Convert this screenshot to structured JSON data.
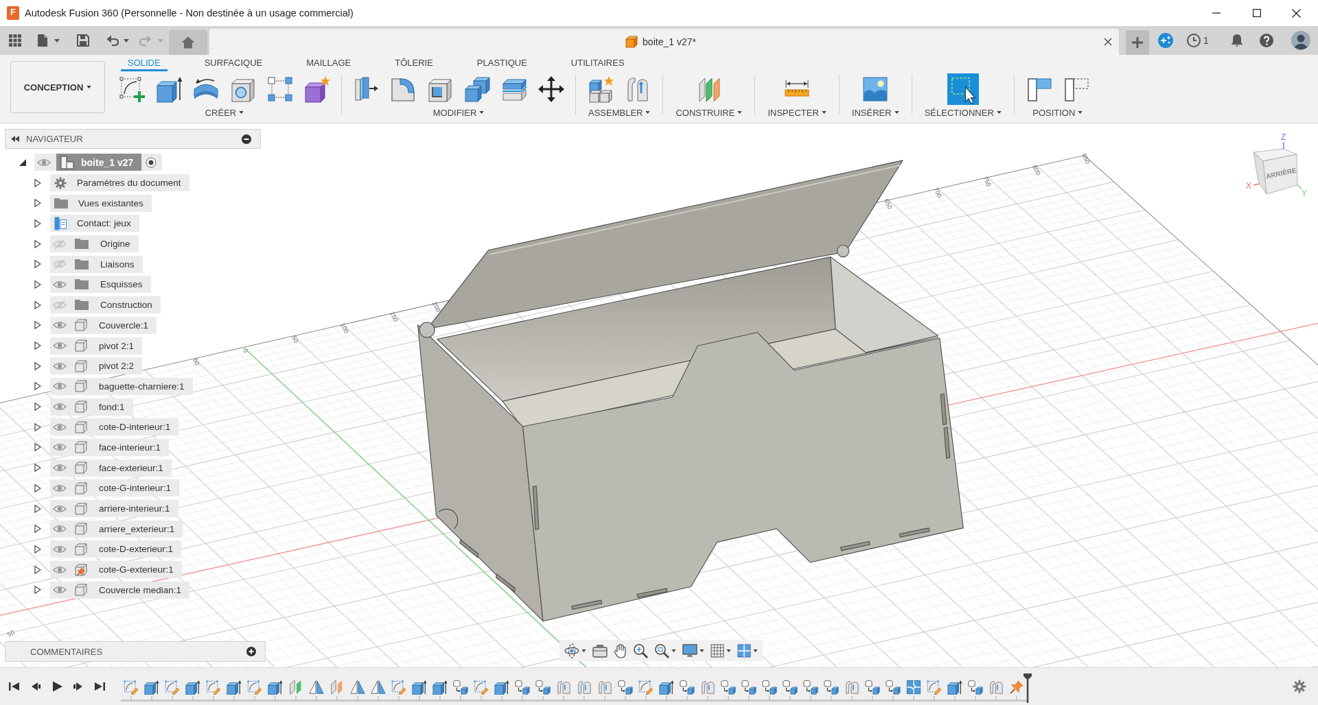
{
  "window": {
    "logo": "F",
    "title": "Autodesk Fusion 360 (Personnelle - Non destinée à un usage commercial)"
  },
  "document_tab": {
    "title": "boite_1 v27*"
  },
  "header_right": {
    "jobs_count": "1"
  },
  "workspace": {
    "label": "CONCEPTION"
  },
  "toolbar": {
    "tabs": [
      {
        "label": "SOLIDE",
        "selected": true
      },
      {
        "label": "SURFACIQUE",
        "selected": false
      },
      {
        "label": "MAILLAGE",
        "selected": false
      },
      {
        "label": "TÔLERIE",
        "selected": false
      },
      {
        "label": "PLASTIQUE",
        "selected": false
      },
      {
        "label": "UTILITAIRES",
        "selected": false
      }
    ],
    "groups": [
      {
        "label": "CRÉER"
      },
      {
        "label": "MODIFIER"
      },
      {
        "label": "ASSEMBLER"
      },
      {
        "label": "CONSTRUIRE"
      },
      {
        "label": "INSPECTER"
      },
      {
        "label": "INSÉRER"
      },
      {
        "label": "SÉLECTIONNER"
      },
      {
        "label": "POSITION"
      }
    ]
  },
  "navigator": {
    "title": "NAVIGATEUR",
    "root": {
      "label": "boite_1 v27",
      "visible": true,
      "expanded": true,
      "active": true,
      "children": [
        {
          "label": "Paramètres du document",
          "kind": "settings",
          "expanded": false
        },
        {
          "label": "Vues existantes",
          "kind": "folder",
          "expanded": false
        },
        {
          "label": "Contact: jeux",
          "kind": "contact",
          "expanded": false
        },
        {
          "label": "Origine",
          "kind": "folder",
          "visible": false,
          "expanded": false
        },
        {
          "label": "Liaisons",
          "kind": "folder",
          "visible": false,
          "expanded": false
        },
        {
          "label": "Esquisses",
          "kind": "folder",
          "visible": true,
          "expanded": false
        },
        {
          "label": "Construction",
          "kind": "folder",
          "visible": false,
          "expanded": false
        },
        {
          "label": "Couvercle:1",
          "kind": "component",
          "visible": true,
          "grounded": false,
          "expanded": false
        },
        {
          "label": "pivot 2:1",
          "kind": "component",
          "visible": true,
          "grounded": false,
          "expanded": false
        },
        {
          "label": "pivot 2:2",
          "kind": "component",
          "visible": true,
          "grounded": false,
          "expanded": false
        },
        {
          "label": "baguette-charniere:1",
          "kind": "component",
          "visible": true,
          "grounded": false,
          "expanded": false
        },
        {
          "label": "fond:1",
          "kind": "component",
          "visible": true,
          "grounded": false,
          "expanded": false
        },
        {
          "label": "cote-D-interieur:1",
          "kind": "component",
          "visible": true,
          "grounded": false,
          "expanded": false
        },
        {
          "label": "face-interieur:1",
          "kind": "component",
          "visible": true,
          "grounded": false,
          "expanded": false
        },
        {
          "label": "face-exterieur:1",
          "kind": "component",
          "visible": true,
          "grounded": false,
          "expanded": false
        },
        {
          "label": "cote-G-interieur:1",
          "kind": "component",
          "visible": true,
          "grounded": false,
          "expanded": false
        },
        {
          "label": "arriere-interieur:1",
          "kind": "component",
          "visible": true,
          "grounded": false,
          "expanded": false
        },
        {
          "label": "arriere_exterieur:1",
          "kind": "component",
          "visible": true,
          "grounded": false,
          "expanded": false
        },
        {
          "label": "cote-D-exterieur:1",
          "kind": "component",
          "visible": true,
          "grounded": false,
          "expanded": false
        },
        {
          "label": "cote-G-exterieur:1",
          "kind": "component",
          "visible": true,
          "grounded": true,
          "expanded": false
        },
        {
          "label": "Couvercle median:1",
          "kind": "component",
          "visible": true,
          "grounded": false,
          "expanded": false
        }
      ]
    }
  },
  "comments": {
    "title": "COMMENTAIRES"
  },
  "viewport": {
    "grid_labels": [
      "50",
      "0",
      "50",
      "100",
      "150",
      "200",
      "650",
      "700",
      "750",
      "800",
      "850"
    ],
    "side_grid_labels": [
      "50"
    ]
  },
  "viewcube": {
    "face": "ARRIÈRE",
    "axis_z": "Z",
    "axis_x": "X",
    "axis_y": "Y"
  },
  "timeline": {
    "features": [
      {
        "kind": "sketch"
      },
      {
        "kind": "extrude"
      },
      {
        "kind": "sketch"
      },
      {
        "kind": "extrude"
      },
      {
        "kind": "sketch"
      },
      {
        "kind": "extrude"
      },
      {
        "kind": "sketch"
      },
      {
        "kind": "extrude"
      },
      {
        "kind": "plane",
        "color": "#4fbf6a"
      },
      {
        "kind": "mirror"
      },
      {
        "kind": "plane",
        "color": "#f0a46a"
      },
      {
        "kind": "mirror"
      },
      {
        "kind": "mirror"
      },
      {
        "kind": "sketch"
      },
      {
        "kind": "extrude"
      },
      {
        "kind": "extrude"
      },
      {
        "kind": "component"
      },
      {
        "kind": "sketch"
      },
      {
        "kind": "extrude"
      },
      {
        "kind": "component"
      },
      {
        "kind": "component"
      },
      {
        "kind": "joint"
      },
      {
        "kind": "joint"
      },
      {
        "kind": "joint"
      },
      {
        "kind": "component"
      },
      {
        "kind": "sketch"
      },
      {
        "kind": "extrude"
      },
      {
        "kind": "component"
      },
      {
        "kind": "joint"
      },
      {
        "kind": "component"
      },
      {
        "kind": "component"
      },
      {
        "kind": "component"
      },
      {
        "kind": "component"
      },
      {
        "kind": "component"
      },
      {
        "kind": "component"
      },
      {
        "kind": "joint"
      },
      {
        "kind": "component"
      },
      {
        "kind": "component"
      },
      {
        "kind": "contact"
      },
      {
        "kind": "sketch"
      },
      {
        "kind": "extrude"
      },
      {
        "kind": "component"
      },
      {
        "kind": "joint"
      },
      {
        "kind": "ground"
      }
    ]
  }
}
